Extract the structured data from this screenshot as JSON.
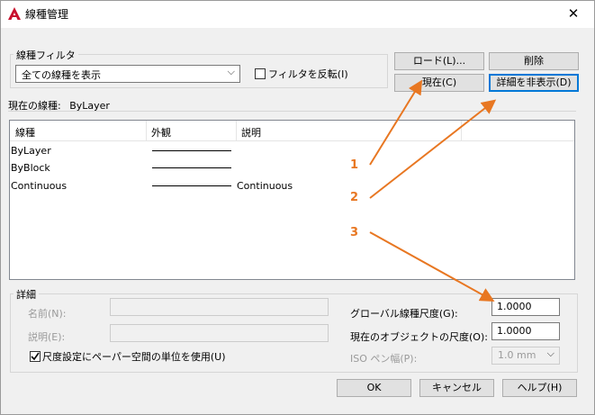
{
  "window": {
    "title": "線種管理",
    "close_glyph": "✕"
  },
  "filter": {
    "group_label": "線種フィルタ",
    "selected": "全ての線種を表示",
    "invert_label": "フィルタを反転(I)"
  },
  "buttons": {
    "load": "ロード(L)...",
    "delete": "削除",
    "current": "現在(C)",
    "hide_details": "詳細を非表示(D)",
    "ok": "OK",
    "cancel": "キャンセル",
    "help": "ヘルプ(H)"
  },
  "current_linetype": {
    "label": "現在の線種:",
    "value": "ByLayer"
  },
  "table": {
    "columns": [
      "線種",
      "外観",
      "説明"
    ],
    "rows": [
      {
        "name": "ByLayer",
        "description": ""
      },
      {
        "name": "ByBlock",
        "description": ""
      },
      {
        "name": "Continuous",
        "description": "Continuous"
      }
    ]
  },
  "details": {
    "group_label": "詳細",
    "name_label": "名前(N):",
    "desc_label": "説明(E):",
    "paper_space_label": "尺度設定にペーパー空間の単位を使用(U)",
    "paper_space_checked": true,
    "global_scale_label": "グローバル線種尺度(G):",
    "global_scale_value": "1.0000",
    "object_scale_label": "現在のオブジェクトの尺度(O):",
    "object_scale_value": "1.0000",
    "pen_width_label": "ISO ペン幅(P):",
    "pen_width_value": "1.0 mm"
  },
  "annotations": {
    "n1": "1",
    "n2": "2",
    "n3": "3",
    "color": "#e87722"
  }
}
